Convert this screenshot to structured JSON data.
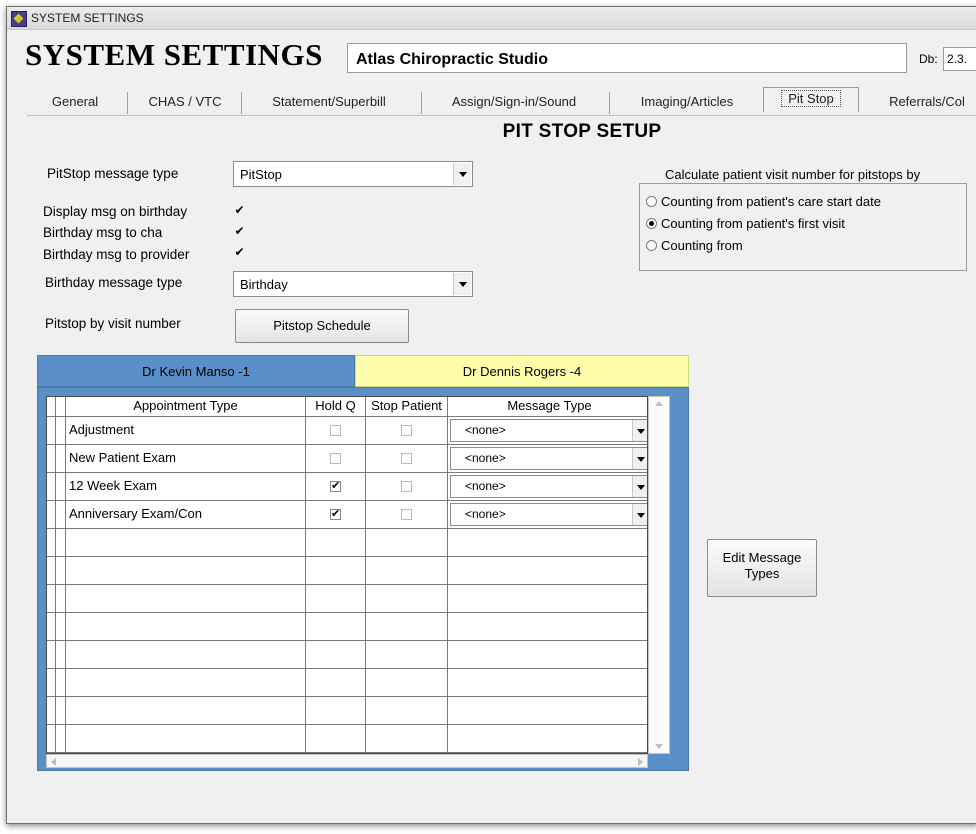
{
  "window": {
    "title": "SYSTEM SETTINGS"
  },
  "header": {
    "title": "SYSTEM SETTINGS",
    "clinic": "Atlas Chiropractic Studio",
    "db_label": "Db:",
    "db_value": "2.3."
  },
  "tabs": [
    "General",
    "CHAS / VTC",
    "Statement/Superbill",
    "Assign/Sign-in/Sound",
    "Imaging/Articles",
    "Pit Stop",
    "Referrals/Col"
  ],
  "active_tab": "Pit Stop",
  "panel_title": "PIT STOP SETUP",
  "form": {
    "pitstop_msg_type_label": "PitStop message type",
    "pitstop_msg_type_value": "PitStop",
    "display_birthday_label": "Display msg on birthday",
    "birthday_cha_label": "Birthday msg to cha",
    "birthday_provider_label": "Birthday msg to provider",
    "birthday_msg_type_label": "Birthday message type",
    "birthday_msg_type_value": "Birthday",
    "pitstop_by_visit_label": "Pitstop by visit number",
    "pitstop_schedule_button": "Pitstop Schedule",
    "checks": {
      "display_birthday": true,
      "birthday_cha": true,
      "birthday_provider": true
    }
  },
  "visit_calc": {
    "label": "Calculate patient visit number for pitstops by",
    "options": [
      "Counting from patient's care start date",
      "Counting from patient's first visit",
      "Counting from"
    ],
    "selected": 1
  },
  "provider_tabs": [
    {
      "label": "Dr Kevin Manso  -1"
    },
    {
      "label": "Dr Dennis Rogers  -4"
    }
  ],
  "grid": {
    "headers": [
      "Appointment Type",
      "Hold Q",
      "Stop Patient",
      "Message Type"
    ],
    "rows": [
      {
        "type": "Adjustment",
        "hold": false,
        "stop": false,
        "message": "<none>"
      },
      {
        "type": "New Patient Exam",
        "hold": false,
        "stop": false,
        "message": "<none>"
      },
      {
        "type": "12 Week Exam",
        "hold": true,
        "stop": false,
        "message": "<none>"
      },
      {
        "type": "Anniversary Exam/Con",
        "hold": true,
        "stop": false,
        "message": "<none>"
      }
    ]
  },
  "edit_message_types_button": "Edit Message Types",
  "check_glyph": "✔"
}
